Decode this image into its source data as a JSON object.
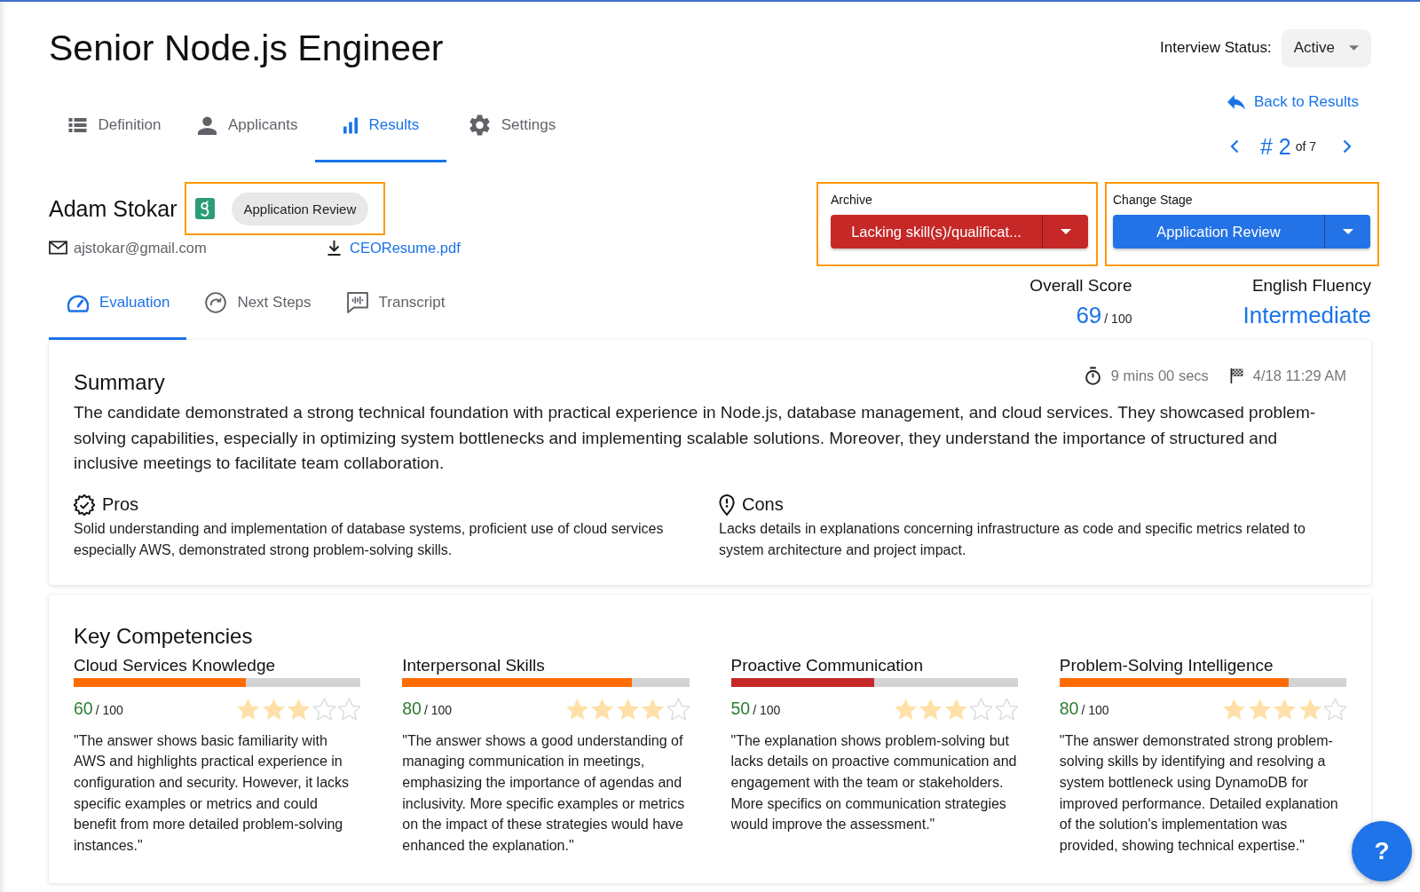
{
  "page_title": "Senior Node.js Engineer",
  "interview_status": {
    "label": "Interview Status:",
    "value": "Active"
  },
  "tabs": [
    {
      "label": "Definition",
      "selected": false
    },
    {
      "label": "Applicants",
      "selected": false
    },
    {
      "label": "Results",
      "selected": true
    },
    {
      "label": "Settings",
      "selected": false
    }
  ],
  "back_link": "Back to Results",
  "pager": {
    "current": "# 2",
    "total": "of 7"
  },
  "candidate": {
    "name": "Adam Stokar",
    "highlighted": true,
    "stage": "Application Review",
    "email": "ajstokar@gmail.com",
    "resume": "CEOResume.pdf"
  },
  "archive": {
    "label": "Archive",
    "value": "Lacking skill(s)/qualificat...",
    "highlighted": true
  },
  "change_stage": {
    "label": "Change Stage",
    "value": "Application Review",
    "highlighted": true
  },
  "scores": [
    {
      "label": "Overall Score",
      "value": "69",
      "scale": "/ 100"
    },
    {
      "label": "English Fluency",
      "value": "Intermediate"
    }
  ],
  "subtabs": [
    {
      "label": "Evaluation",
      "selected": true
    },
    {
      "label": "Next Steps",
      "selected": false
    },
    {
      "label": "Transcript",
      "selected": false
    }
  ],
  "summary": {
    "title": "Summary",
    "duration": "9 mins 00 secs",
    "date": "4/18 11:29 AM",
    "text": "The candidate demonstrated a strong technical foundation with practical experience in Node.js, database management, and cloud services. They showcased problem-solving capabilities, especially in optimizing system bottlenecks and implementing scalable solutions. Moreover, they understand the importance of structured and inclusive meetings to facilitate team collaboration.",
    "pros": {
      "title": "Pros",
      "text": "Solid understanding and implementation of database systems, proficient use of cloud services especially AWS, demonstrated strong problem-solving skills."
    },
    "cons": {
      "title": "Cons",
      "text": "Lacks details in explanations concerning infrastructure as code and specific metrics related to system architecture and project impact."
    }
  },
  "key_competencies": {
    "title": "Key Competencies",
    "items": [
      {
        "name": "Cloud Services Knowledge",
        "level": 0.6,
        "color": "#ff6d00",
        "score": "60",
        "scale": "/ 100",
        "stars": 3,
        "comment": "\"The answer shows basic familiarity with AWS and highlights practical experience in configuration and security. However, it lacks specific examples or metrics and could benefit from more detailed problem-solving instances.\""
      },
      {
        "name": "Interpersonal Skills",
        "level": 0.8,
        "color": "#ff6d00",
        "score": "80",
        "scale": "/ 100",
        "stars": 4,
        "comment": "\"The answer shows a good understanding of managing communication in meetings, emphasizing the importance of agendas and inclusivity. More specific examples or metrics on the impact of these strategies would have enhanced the explanation.\""
      },
      {
        "name": "Proactive Communication",
        "level": 0.5,
        "color": "#c62828",
        "score": "50",
        "scale": "/ 100",
        "stars": 3,
        "comment": "\"The explanation shows problem-solving but lacks details on proactive communication and engagement with the team or stakeholders. More specifics on communication strategies would improve the assessment.\""
      },
      {
        "name": "Problem-Solving Intelligence",
        "level": 0.8,
        "color": "#ff6d00",
        "score": "80",
        "scale": "/ 100",
        "stars": 4,
        "comment": "\"The answer demonstrated strong problem-solving skills by identifying and resolving a system bottleneck using DynamoDB for improved performance. Detailed explanation of the solution's implementation was provided, showing technical expertise.\""
      }
    ]
  },
  "help_button": "?"
}
